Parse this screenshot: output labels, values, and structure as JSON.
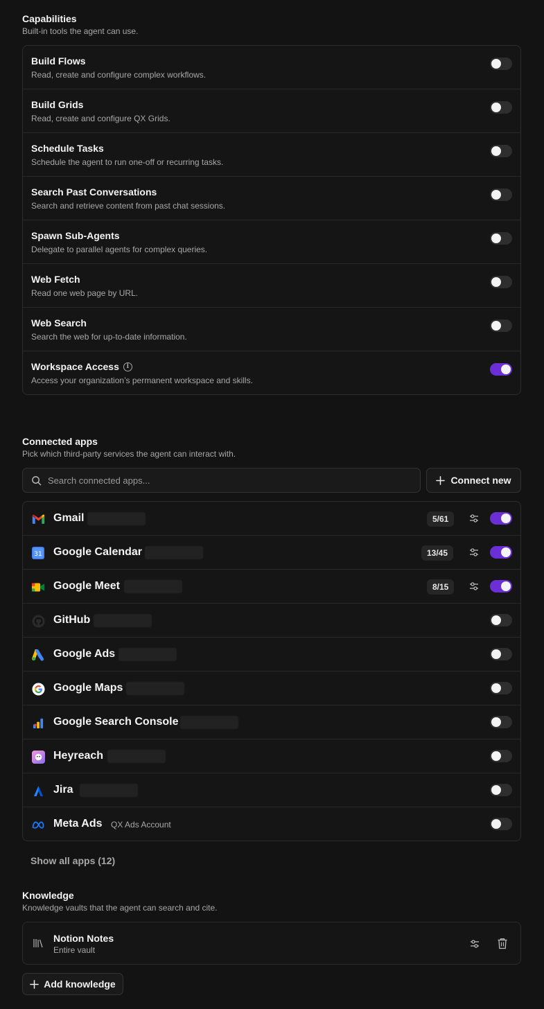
{
  "capabilities": {
    "title": "Capabilities",
    "subtitle": "Built-in tools the agent can use.",
    "items": [
      {
        "title": "Build Flows",
        "desc": "Read, create and configure complex workflows.",
        "enabled": false
      },
      {
        "title": "Build Grids",
        "desc": "Read, create and configure QX Grids.",
        "enabled": false
      },
      {
        "title": "Schedule Tasks",
        "desc": "Schedule the agent to run one-off or recurring tasks.",
        "enabled": false
      },
      {
        "title": "Search Past Conversations",
        "desc": "Search and retrieve content from past chat sessions.",
        "enabled": false
      },
      {
        "title": "Spawn Sub-Agents",
        "desc": "Delegate to parallel agents for complex queries.",
        "enabled": false
      },
      {
        "title": "Web Fetch",
        "desc": "Read one web page by URL.",
        "enabled": false
      },
      {
        "title": "Web Search",
        "desc": "Search the web for up-to-date information.",
        "enabled": false
      },
      {
        "title": "Workspace Access",
        "desc": "Access your organization’s permanent workspace and skills.",
        "enabled": true,
        "info_icon": "info-icon"
      }
    ]
  },
  "connected_apps": {
    "title": "Connected apps",
    "subtitle": "Pick which third-party services the agent can interact with.",
    "search_placeholder": "Search connected apps...",
    "connect_label": "Connect new",
    "apps": [
      {
        "name": "Gmail",
        "icon": "gmail-icon",
        "count": "5/61",
        "enabled": true
      },
      {
        "name": "Google Calendar",
        "icon": "google-calendar-icon",
        "count": "13/45",
        "enabled": true
      },
      {
        "name": "Google Meet",
        "icon": "google-meet-icon",
        "count": "8/15",
        "enabled": true
      },
      {
        "name": "GitHub",
        "icon": "github-icon",
        "enabled": false
      },
      {
        "name": "Google Ads",
        "icon": "google-ads-icon",
        "enabled": false
      },
      {
        "name": "Google Maps",
        "icon": "google-maps-icon",
        "enabled": false
      },
      {
        "name": "Google Search Console",
        "icon": "google-search-console-icon",
        "enabled": false
      },
      {
        "name": "Heyreach",
        "icon": "heyreach-icon",
        "enabled": false
      },
      {
        "name": "Jira",
        "icon": "jira-icon",
        "enabled": false
      },
      {
        "name": "Meta Ads",
        "icon": "meta-icon",
        "account": "QX Ads Account",
        "enabled": false
      }
    ],
    "show_all_label": "Show all apps (12)"
  },
  "knowledge": {
    "title": "Knowledge",
    "subtitle": "Knowledge vaults that the agent can search and cite.",
    "items": [
      {
        "title": "Notion Notes",
        "sub": "Entire vault",
        "icon": "library-icon"
      }
    ],
    "add_label": "Add knowledge"
  },
  "colors": {
    "background": "#131313",
    "toggle_on": "#6b2fd6",
    "toggle_off": "#2e2e2e"
  }
}
